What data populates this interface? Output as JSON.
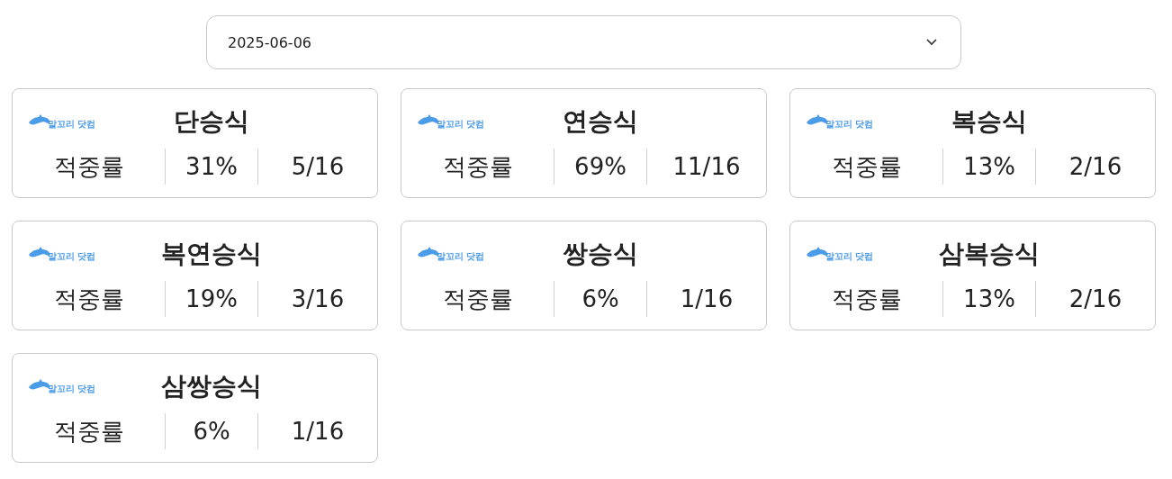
{
  "date_select": {
    "value": "2025-06-06"
  },
  "cards": [
    {
      "logo_text": "말꼬리 닷컴",
      "title": "단승식",
      "label": "적중률",
      "rate": "31%",
      "count": "5/16"
    },
    {
      "logo_text": "말꼬리 닷컴",
      "title": "연승식",
      "label": "적중률",
      "rate": "69%",
      "count": "11/16"
    },
    {
      "logo_text": "말꼬리 닷컴",
      "title": "복승식",
      "label": "적중률",
      "rate": "13%",
      "count": "2/16"
    },
    {
      "logo_text": "말꼬리 닷컴",
      "title": "복연승식",
      "label": "적중률",
      "rate": "19%",
      "count": "3/16"
    },
    {
      "logo_text": "말꼬리 닷컴",
      "title": "쌍승식",
      "label": "적중률",
      "rate": "6%",
      "count": "1/16"
    },
    {
      "logo_text": "말꼬리 닷컴",
      "title": "삼복승식",
      "label": "적중률",
      "rate": "13%",
      "count": "2/16"
    },
    {
      "logo_text": "말꼬리 닷컴",
      "title": "삼쌍승식",
      "label": "적중률",
      "rate": "6%",
      "count": "1/16"
    }
  ]
}
